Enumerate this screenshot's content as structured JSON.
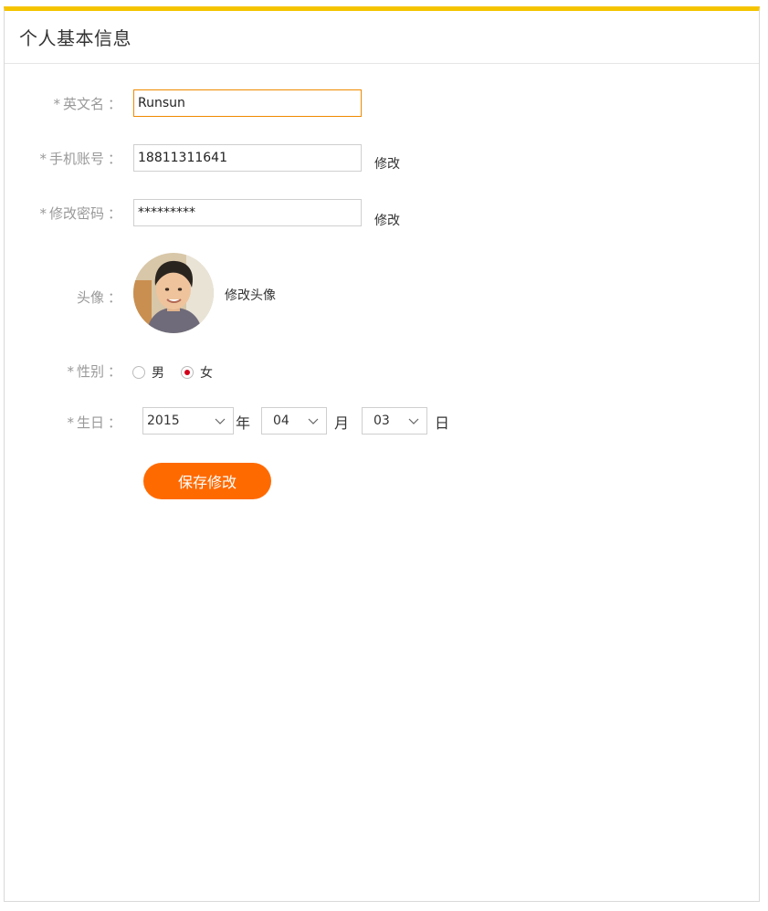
{
  "header": {
    "title": "个人基本信息"
  },
  "form": {
    "english_name": {
      "label": "英文名",
      "value": "Runsun"
    },
    "phone": {
      "label": "手机账号",
      "value": "18811311641",
      "action": "修改"
    },
    "password": {
      "label": "修改密码",
      "value": "*********",
      "action": "修改"
    },
    "avatar": {
      "label": "头像",
      "action": "修改头像"
    },
    "gender": {
      "label": "性别",
      "options": [
        "男",
        "女"
      ],
      "selected": "女"
    },
    "birthday": {
      "label": "生日",
      "year": "2015",
      "year_unit": "年",
      "month": "04",
      "month_unit": "月",
      "day": "03",
      "day_unit": "日"
    },
    "required_mark": "*",
    "colon": "："
  },
  "actions": {
    "save_label": "保存修改"
  },
  "colors": {
    "accent_top_border": "#f5c400",
    "primary_button": "#ff6a00",
    "focus_border": "#f08a00",
    "radio_checked": "#d4001b"
  }
}
